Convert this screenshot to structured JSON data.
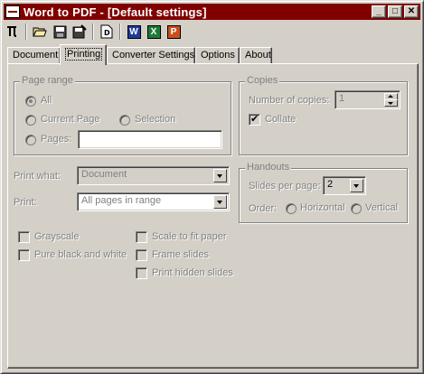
{
  "window": {
    "title": "Word to PDF - [Default settings]",
    "controls": {
      "minimize": "_",
      "maximize": "□",
      "close": "✕"
    }
  },
  "toolbar": {
    "icons": [
      "pdf-mark-icon",
      "open-folder-icon",
      "save-icon",
      "save-as-icon",
      "document-info-icon",
      "word-app-icon",
      "excel-app-icon",
      "powerpoint-app-icon"
    ],
    "word_letter": "W",
    "excel_letter": "X",
    "ppt_letter": "P",
    "colors": {
      "word": "#1f3a9a",
      "excel": "#1e7a38",
      "powerpoint": "#c8501e"
    }
  },
  "tabs": [
    {
      "label": "Document",
      "active": false
    },
    {
      "label": "Printing",
      "active": true
    },
    {
      "label": "Converter Settings",
      "active": false
    },
    {
      "label": "Options",
      "active": false
    },
    {
      "label": "About",
      "active": false
    }
  ],
  "page_range": {
    "label": "Page range",
    "all": "All",
    "current_page": "Current Page",
    "selection": "Selection",
    "pages": "Pages:",
    "pages_value": "",
    "selected": "All"
  },
  "copies": {
    "label": "Copies",
    "number_label": "Number of copies:",
    "number_value": "1",
    "collate_label": "Collate",
    "collate_checked": true
  },
  "print_what": {
    "label": "Print what:",
    "value": "Document"
  },
  "print": {
    "label": "Print:",
    "value": "All pages in range"
  },
  "handouts": {
    "label": "Handouts",
    "slides_label": "Slides per page:",
    "slides_value": "2",
    "order_label": "Order:",
    "horizontal": "Horizontal",
    "vertical": "Vertical"
  },
  "options": {
    "grayscale": "Grayscale",
    "pure_bw": "Pure black and white",
    "scale_to_fit": "Scale to fit paper",
    "frame_slides": "Frame slides",
    "print_hidden": "Print hidden slides"
  }
}
